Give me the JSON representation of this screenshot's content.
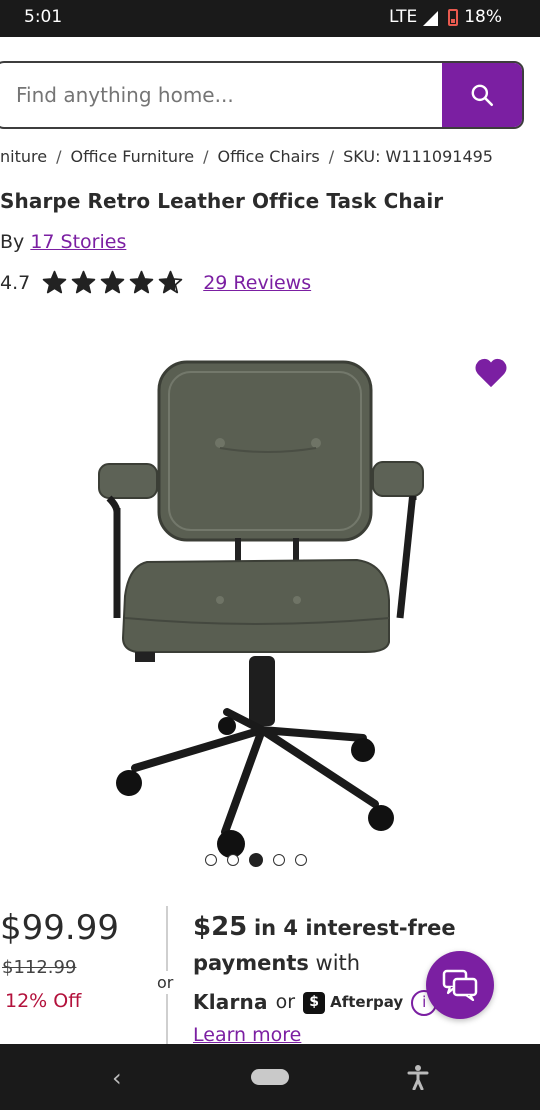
{
  "status_bar": {
    "time": "5:01",
    "network": "LTE",
    "battery": "18%"
  },
  "search": {
    "placeholder": "Find anything home..."
  },
  "breadcrumb": {
    "items": [
      "niture",
      "Office Furniture",
      "Office Chairs"
    ],
    "separator": "/",
    "sku": "SKU: W111091495"
  },
  "product": {
    "title": "Sharpe Retro Leather Office Task Chair",
    "by_label": "By",
    "brand": "17 Stories",
    "rating": "4.7",
    "rating_value": 4.7,
    "rating_max": 5,
    "reviews": "29 Reviews",
    "image_count": 5,
    "active_image": 3
  },
  "pricing": {
    "price": "$99.99",
    "was_price": "$112.99",
    "discount": "12% Off",
    "or": "or",
    "installment_amount": "$25",
    "installment_text": "in 4 interest-free",
    "payments_word": "payments",
    "with_word": "with",
    "provider_1": "Klarna",
    "provider_or": "or",
    "provider_2": "Afterpay",
    "learn_more": "Learn more"
  },
  "colors": {
    "accent": "#7b1fa2",
    "discount": "#b3123c",
    "system_bar": "#1a1a1a"
  },
  "icons": {
    "search": "search-icon",
    "heart": "heart-icon",
    "chat": "chat-icon",
    "info": "info-icon"
  }
}
